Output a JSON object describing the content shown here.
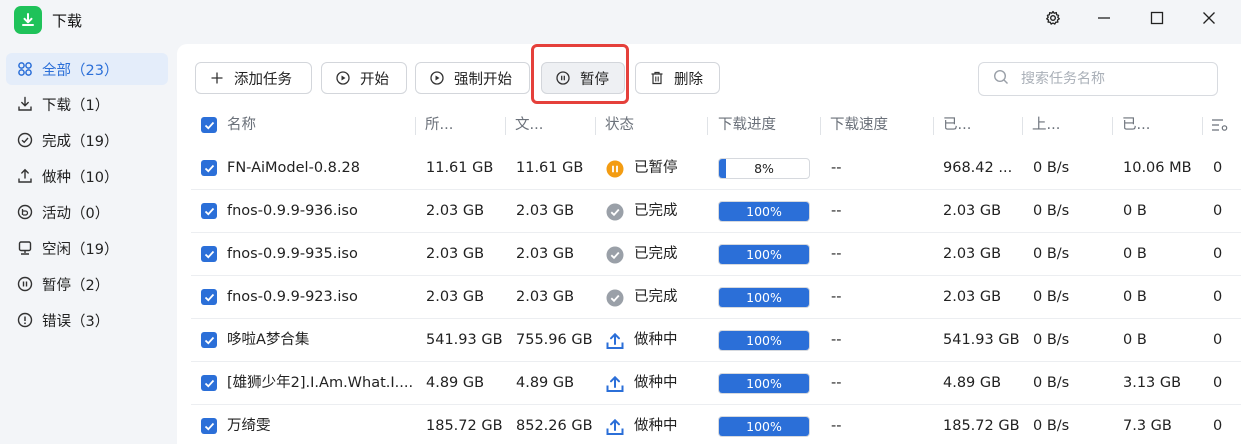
{
  "app": {
    "title": "下载"
  },
  "sidebar": {
    "items": [
      {
        "label": "全部（23）",
        "icon": "grid-icon",
        "active": true
      },
      {
        "label": "下载（1）",
        "icon": "download-icon"
      },
      {
        "label": "完成（19）",
        "icon": "check-circle-icon"
      },
      {
        "label": "做种（10）",
        "icon": "upload-icon"
      },
      {
        "label": "活动（0）",
        "icon": "activity-icon"
      },
      {
        "label": "空闲（19）",
        "icon": "idle-icon"
      },
      {
        "label": "暂停（2）",
        "icon": "pause-circle-icon"
      },
      {
        "label": "错误（3）",
        "icon": "error-icon"
      }
    ]
  },
  "toolbar": {
    "add_label": "添加任务",
    "start_label": "开始",
    "force_start_label": "强制开始",
    "pause_label": "暂停",
    "delete_label": "删除",
    "search_placeholder": "搜索任务名称"
  },
  "table": {
    "columns": [
      "名称",
      "所...",
      "文...",
      "状态",
      "下载进度",
      "下载速度",
      "已...",
      "上...",
      "已..."
    ],
    "rows": [
      {
        "name": "FN-AiModel-0.8.28",
        "size": "11.61 GB",
        "file": "11.61 GB",
        "status": "已暂停",
        "status_type": "paused",
        "progress_label": "8%",
        "progress": 0.08,
        "speed": "--",
        "downloaded": "968.42 ...",
        "upload": "0 B/s",
        "uploaded": "10.06 MB",
        "extra": "0"
      },
      {
        "name": "fnos-0.9.9-936.iso",
        "size": "2.03 GB",
        "file": "2.03 GB",
        "status": "已完成",
        "status_type": "done",
        "progress_label": "100%",
        "progress": 1.0,
        "speed": "--",
        "downloaded": "2.03 GB",
        "upload": "0 B/s",
        "uploaded": "0 B",
        "extra": "0"
      },
      {
        "name": "fnos-0.9.9-935.iso",
        "size": "2.03 GB",
        "file": "2.03 GB",
        "status": "已完成",
        "status_type": "done",
        "progress_label": "100%",
        "progress": 1.0,
        "speed": "--",
        "downloaded": "2.03 GB",
        "upload": "0 B/s",
        "uploaded": "0 B",
        "extra": "0"
      },
      {
        "name": "fnos-0.9.9-923.iso",
        "size": "2.03 GB",
        "file": "2.03 GB",
        "status": "已完成",
        "status_type": "done",
        "progress_label": "100%",
        "progress": 1.0,
        "speed": "--",
        "downloaded": "2.03 GB",
        "upload": "0 B/s",
        "uploaded": "0 B",
        "extra": "0"
      },
      {
        "name": "哆啦A梦合集",
        "size": "541.93 GB",
        "file": "755.96 GB",
        "status": "做种中",
        "status_type": "seeding",
        "progress_label": "100%",
        "progress": 1.0,
        "speed": "--",
        "downloaded": "541.93 GB",
        "upload": "0 B/s",
        "uploaded": "0 B",
        "extra": "0"
      },
      {
        "name": "[雄狮少年2].I.Am.What.I....",
        "size": "4.89 GB",
        "file": "4.89 GB",
        "status": "做种中",
        "status_type": "seeding",
        "progress_label": "100%",
        "progress": 1.0,
        "speed": "--",
        "downloaded": "4.89 GB",
        "upload": "0 B/s",
        "uploaded": "3.13 GB",
        "extra": "0"
      },
      {
        "name": "万绮雯",
        "size": "185.72 GB",
        "file": "852.26 GB",
        "status": "做种中",
        "status_type": "seeding",
        "progress_label": "100%",
        "progress": 1.0,
        "speed": "--",
        "downloaded": "185.72 GB",
        "upload": "0 B/s",
        "uploaded": "7.3 GB",
        "extra": "0"
      }
    ]
  },
  "colors": {
    "accent": "#2b6fd8",
    "paused": "#f39c12",
    "done": "#9aa0a8",
    "app": "#1fc25a",
    "highlight": "#e5403b"
  }
}
